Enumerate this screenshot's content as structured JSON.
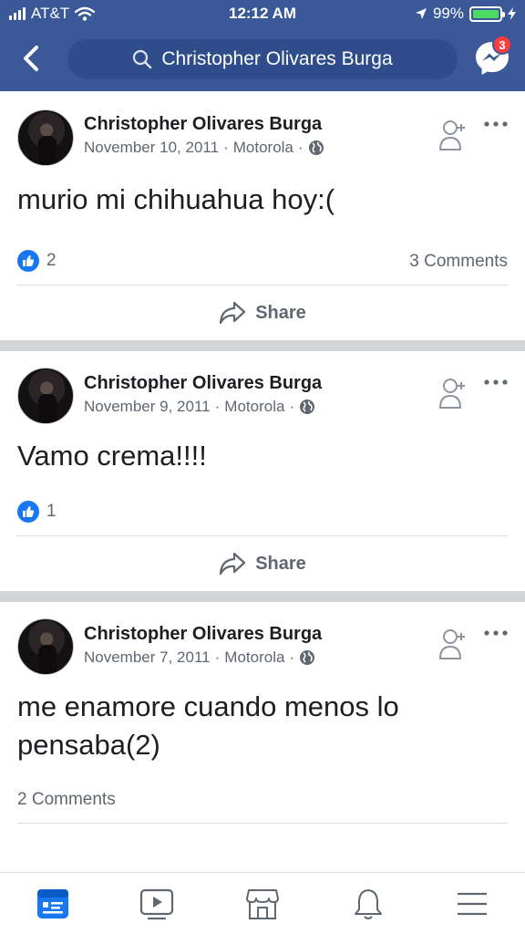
{
  "status": {
    "carrier": "AT&T",
    "time": "12:12 AM",
    "battery": "99%",
    "battery_level": 0.99
  },
  "header": {
    "search_text": "Christopher Olivares Burga",
    "messenger_badge": "3"
  },
  "posts": [
    {
      "author": "Christopher Olivares Burga",
      "date": "November 10, 2011",
      "via": "Motorola",
      "sep": "·",
      "text": "murio mi chihuahua hoy:(",
      "likes": "2",
      "comments": "3 Comments",
      "share": "Share"
    },
    {
      "author": "Christopher Olivares Burga",
      "date": "November 9, 2011",
      "via": "Motorola",
      "sep": "·",
      "text": "Vamo crema!!!!",
      "likes": "1",
      "share": "Share"
    },
    {
      "author": "Christopher Olivares Burga",
      "date": "November 7, 2011",
      "via": "Motorola",
      "sep": "·",
      "text": "me enamore cuando menos lo pensaba(2)",
      "comments": "2 Comments"
    }
  ],
  "tabbar": {
    "icons": [
      "news-feed-icon",
      "watch-icon",
      "marketplace-icon",
      "notifications-icon",
      "menu-icon"
    ],
    "active_color": "#1877f2",
    "inactive_color": "#606770"
  },
  "colors": {
    "brand": "#3b5998",
    "like": "#1877f2"
  }
}
